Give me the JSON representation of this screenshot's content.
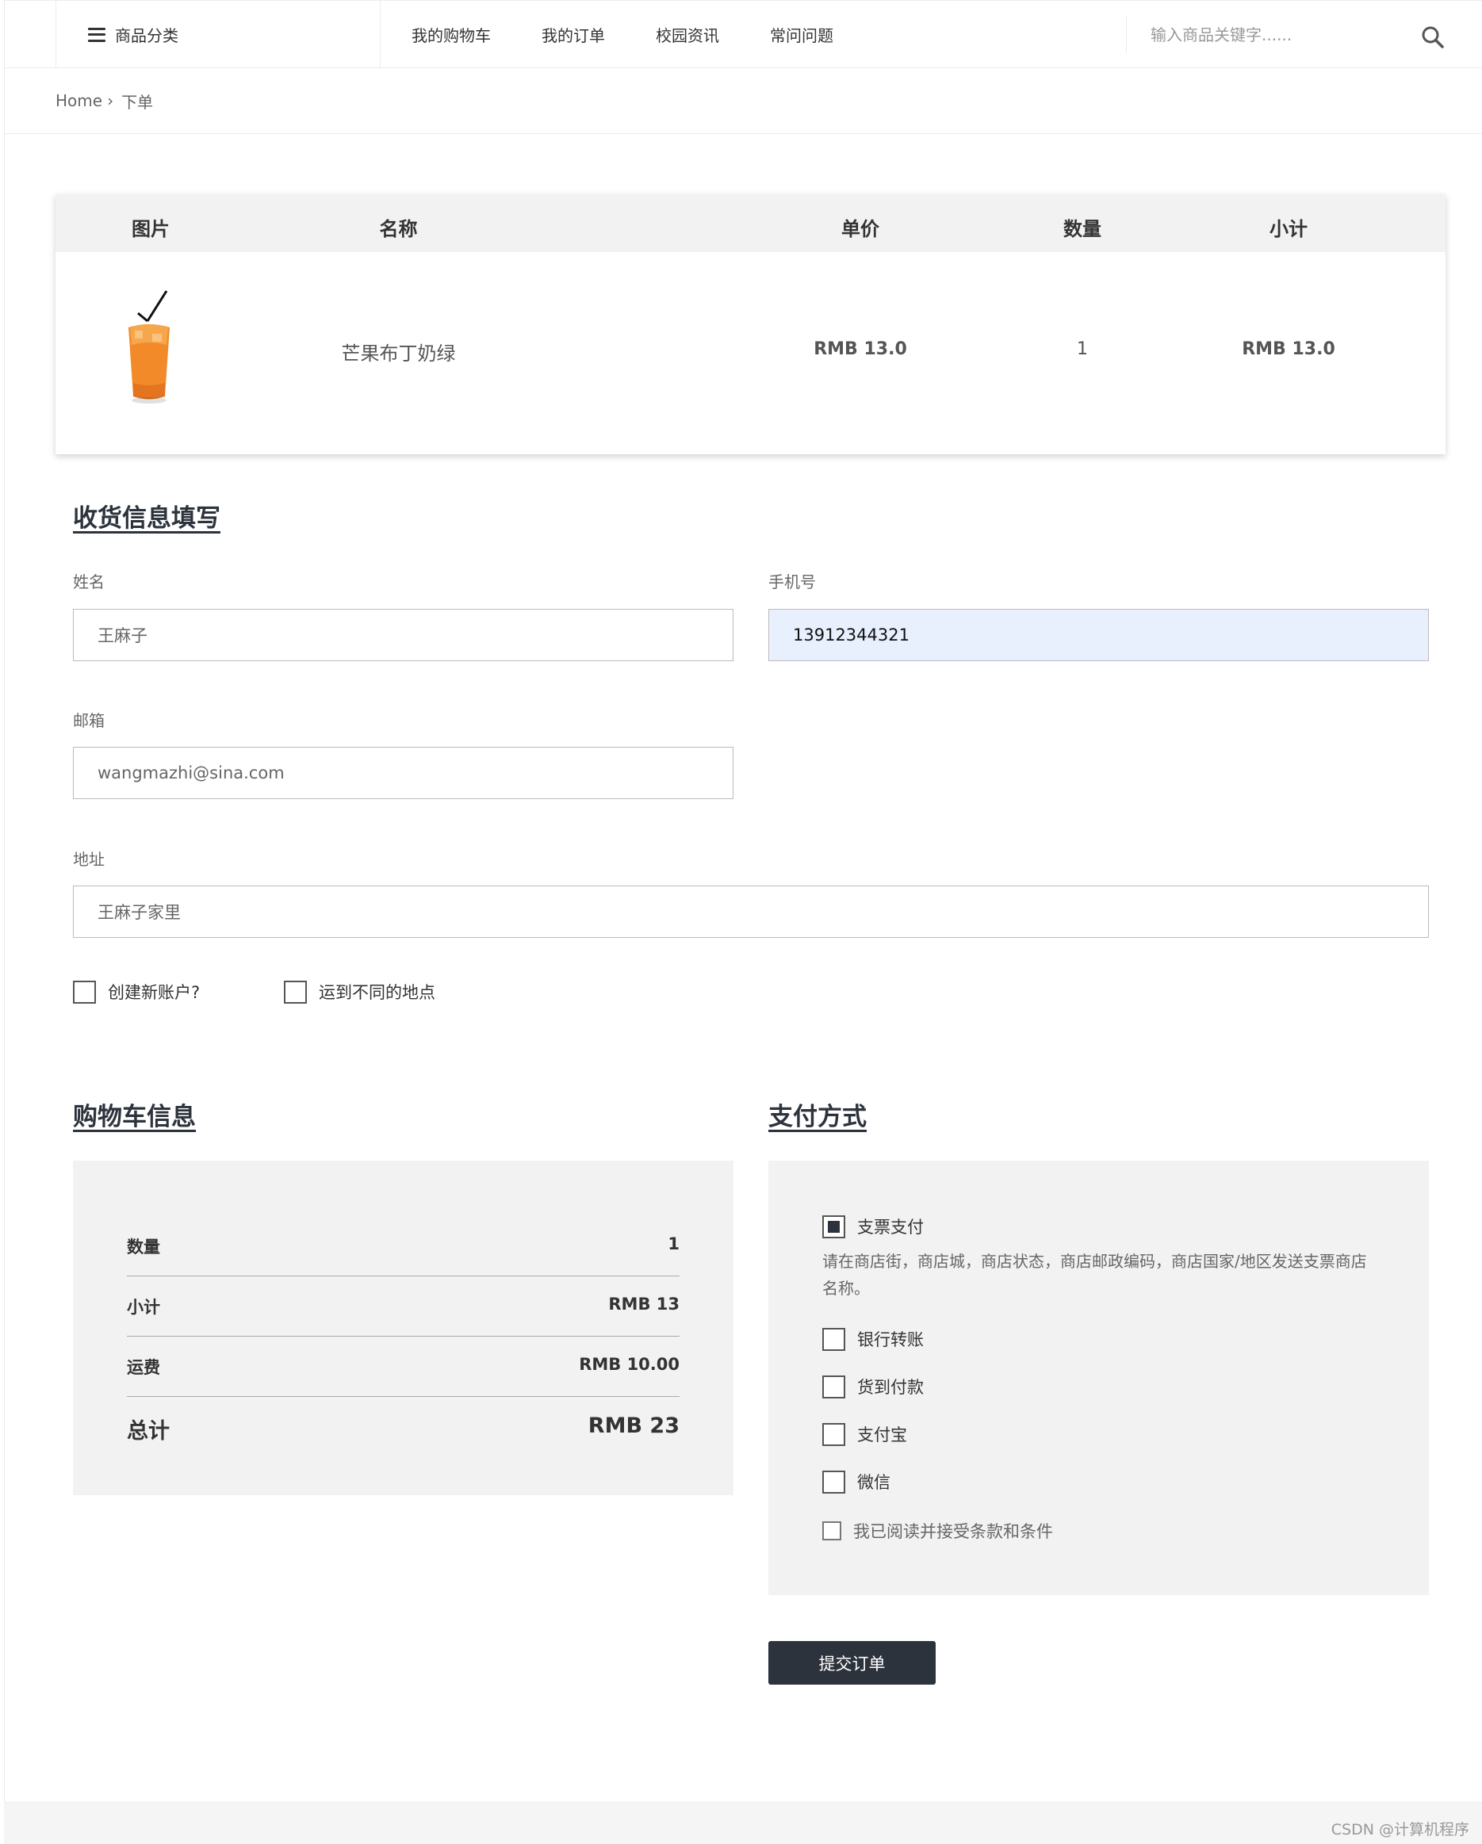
{
  "nav": {
    "category_label": "商品分类",
    "menu": [
      "我的购物车",
      "我的订单",
      "校园资讯",
      "常问问题"
    ],
    "search_placeholder": "输入商品关键字......"
  },
  "breadcrumb": {
    "home": "Home",
    "separator": "›",
    "current": "下单"
  },
  "order_table": {
    "headers": [
      "图片",
      "名称",
      "单价",
      "数量",
      "小计"
    ],
    "rows": [
      {
        "image": "iced-orange-drink-photo",
        "name": "芒果布丁奶绿",
        "price": "RMB 13.0",
        "qty": "1",
        "subtotal": "RMB 13.0"
      }
    ]
  },
  "shipping": {
    "title": "收货信息填写",
    "name_label": "姓名",
    "name_value": "王麻子",
    "phone_label": "手机号",
    "phone_value": "13912344321",
    "email_label": "邮箱",
    "email_value": "wangmazhi@sina.com",
    "address_label": "地址",
    "address_value": "王麻子家里",
    "create_account": "创建新账户?",
    "ship_different": "运到不同的地点"
  },
  "cart": {
    "title": "购物车信息",
    "qty_label": "数量",
    "qty_value": "1",
    "subtotal_label": "小计",
    "subtotal_value": "RMB 13",
    "shipping_label": "运费",
    "shipping_value": "RMB 10.00",
    "total_label": "总计",
    "total_value": "RMB 23"
  },
  "payment": {
    "title": "支付方式",
    "cheque": "支票支付",
    "cheque_desc": "请在商店街，商店城，商店状态，商店邮政编码，商店国家/地区发送支票商店名称。",
    "bank": "银行转账",
    "cod": "货到付款",
    "alipay": "支付宝",
    "wechat": "微信",
    "terms": "我已阅读并接受条款和条件",
    "selected": "支票支付"
  },
  "submit_label": "提交订单",
  "watermark": "CSDN @计算机程序",
  "colors": {
    "dark": "#2d333d",
    "panel": "#f2f2f2",
    "autofill": "#e8f0fe"
  }
}
